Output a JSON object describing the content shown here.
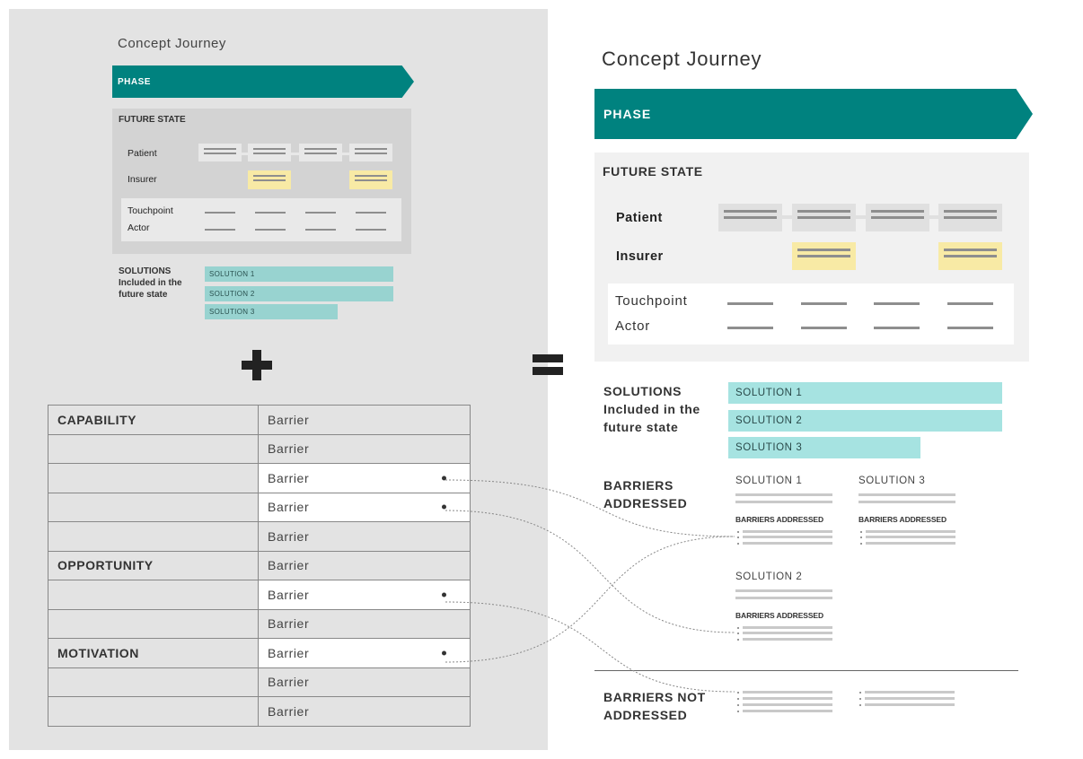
{
  "small_journey": {
    "title": "Concept Journey",
    "phase": "PHASE",
    "future_state": "FUTURE STATE",
    "rows": [
      "Patient",
      "Insurer"
    ],
    "sub_rows": [
      "Touchpoint",
      "Actor"
    ],
    "solutions_heading": "SOLUTIONS\nIncluded in the\nfuture state",
    "solutions": [
      "SOLUTION 1",
      "SOLUTION 2",
      "SOLUTION 3"
    ]
  },
  "operators": {
    "plus": "+",
    "equals": "="
  },
  "com_table": {
    "rows": [
      {
        "category": "CAPABILITY",
        "barrier": "Barrier",
        "highlight": false
      },
      {
        "category": "",
        "barrier": "Barrier",
        "highlight": false
      },
      {
        "category": "",
        "barrier": "Barrier",
        "highlight": true
      },
      {
        "category": "",
        "barrier": "Barrier",
        "highlight": true
      },
      {
        "category": "",
        "barrier": "Barrier",
        "highlight": false
      },
      {
        "category": "OPPORTUNITY",
        "barrier": "Barrier",
        "highlight": false
      },
      {
        "category": "",
        "barrier": "Barrier",
        "highlight": true
      },
      {
        "category": "",
        "barrier": "Barrier",
        "highlight": false
      },
      {
        "category": "MOTIVATION",
        "barrier": "Barrier",
        "highlight": true
      },
      {
        "category": "",
        "barrier": "Barrier",
        "highlight": false
      },
      {
        "category": "",
        "barrier": "Barrier",
        "highlight": false
      }
    ]
  },
  "big_journey": {
    "title": "Concept Journey",
    "phase": "PHASE",
    "future_state": "FUTURE STATE",
    "rows": [
      "Patient",
      "Insurer"
    ],
    "sub_rows": [
      "Touchpoint",
      "Actor"
    ],
    "solutions_heading": "SOLUTIONS\nIncluded in the\nfuture state",
    "solutions": [
      "SOLUTION 1",
      "SOLUTION 2",
      "SOLUTION 3"
    ],
    "barriers_addressed_heading": "BARRIERS\nADDRESSED",
    "solution_cards": [
      {
        "title": "SOLUTION 1",
        "label": "BARRIERS ADDRESSED"
      },
      {
        "title": "SOLUTION 3",
        "label": "BARRIERS ADDRESSED"
      },
      {
        "title": "SOLUTION 2",
        "label": "BARRIERS ADDRESSED"
      }
    ],
    "barriers_not_addressed_heading": "BARRIERS NOT\nADDRESSED"
  },
  "colors": {
    "teal": "#00827f",
    "solution_bar": "#a6e3e1",
    "highlight_yellow": "#f8eaa5",
    "left_background": "#e3e3e3"
  }
}
